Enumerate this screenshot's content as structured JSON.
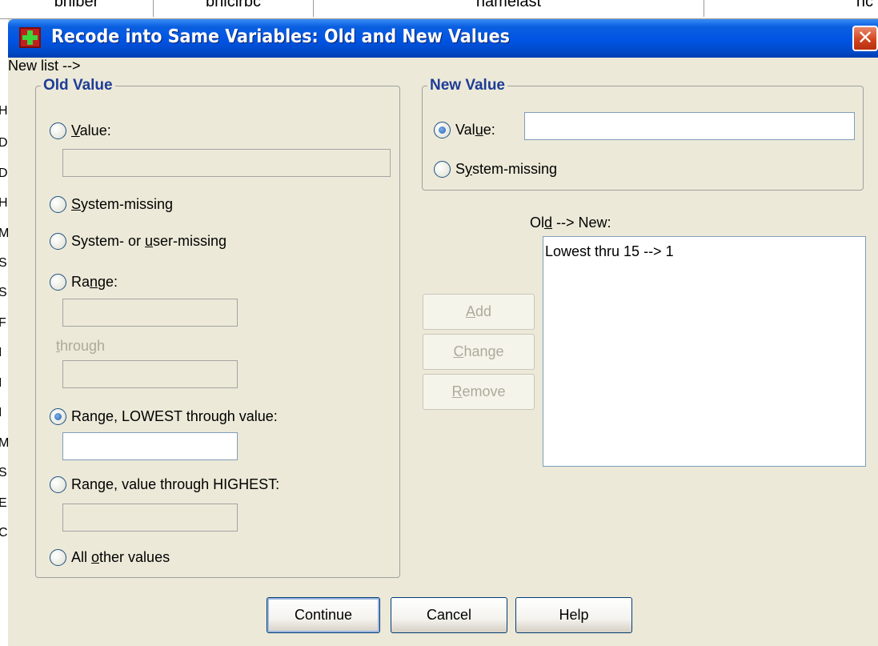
{
  "background": {
    "columns": [
      "bniber",
      "bnicirbc",
      "namelast",
      "nc"
    ],
    "row_letters": [
      "H",
      "D",
      "D",
      "H",
      "M",
      "S",
      "S",
      "F",
      "I",
      "I",
      "I",
      "M",
      "S",
      "E",
      "C"
    ]
  },
  "window": {
    "title": "Recode into Same Variables: Old and New Values",
    "close_label": "✕",
    "title_color": "#0054e3"
  },
  "old_value": {
    "legend": "Old Value",
    "value": {
      "label_u": "V",
      "label_rest": "alue:",
      "input": ""
    },
    "system_missing": {
      "label_u": "S",
      "label_rest": "ystem-missing"
    },
    "sys_or_user_missing": {
      "label_pre": "System- or ",
      "label_u": "u",
      "label_rest": "ser-missing"
    },
    "range": {
      "label_pre": "Ra",
      "label_u": "n",
      "label_rest": "ge:",
      "from": "",
      "through_label_u": "t",
      "through_label_rest": "hrough",
      "to": ""
    },
    "range_lowest": {
      "label_pre": "Range, LOWEST through value:",
      "input": ""
    },
    "range_highest": {
      "label_pre": "Range",
      "label_u": ",",
      "label_rest": " value through HIGHEST:",
      "input": ""
    },
    "all_other": {
      "label_pre": "All ",
      "label_u": "o",
      "label_rest": "ther values"
    },
    "selected": "range_lowest"
  },
  "new_value": {
    "legend": "New Value",
    "value": {
      "label_pre": "Val",
      "label_u": "u",
      "label_rest": "e:",
      "input": ""
    },
    "system_missing": {
      "label_pre": "S",
      "label_u": "y",
      "label_rest": "stem-missing"
    },
    "selected": "value"
  },
  "old_new": {
    "label_pre": "Ol",
    "label_u": "d",
    "label_rest": " --> New:",
    "items": [
      "Lowest thru 15 --> 1"
    ]
  },
  "buttons": {
    "add": {
      "u": "A",
      "rest": "dd"
    },
    "change": {
      "u": "C",
      "rest": "hange"
    },
    "remove": {
      "u": "R",
      "rest": "emove"
    },
    "continue": "Continue",
    "cancel": "Cancel",
    "help": "Help"
  }
}
